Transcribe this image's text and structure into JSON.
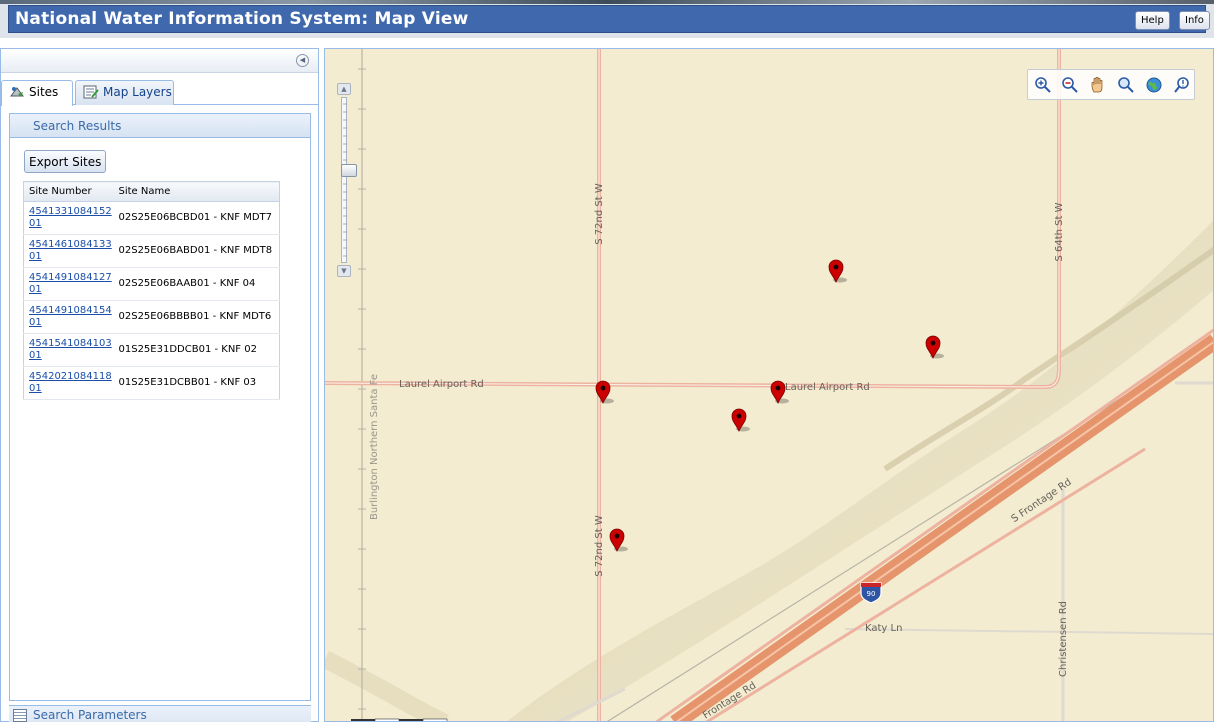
{
  "header": {
    "title": "National Water Information System: Map View",
    "help_label": "Help",
    "info_label": "Info"
  },
  "tabs": [
    {
      "label": "Sites",
      "icon": "sites-icon",
      "selected": true
    },
    {
      "label": "Map Layers",
      "icon": "map-layers-icon",
      "selected": false
    }
  ],
  "results": {
    "title": "Search Results",
    "export_label": "Export Sites",
    "columns": [
      "Site Number",
      "Site Name"
    ],
    "rows": [
      {
        "number": "454133108415201",
        "name": "02S25E06BCBD01 - KNF MDT7"
      },
      {
        "number": "454146108413301",
        "name": "02S25E06BABD01 - KNF MDT8"
      },
      {
        "number": "454149108412701",
        "name": "02S25E06BAAB01 - KNF 04"
      },
      {
        "number": "454149108415401",
        "name": "02S25E06BBBB01 - KNF MDT6"
      },
      {
        "number": "454154108410301",
        "name": "01S25E31DDCB01 - KNF 02"
      },
      {
        "number": "454202108411801",
        "name": "01S25E31DCBB01 - KNF 03"
      }
    ]
  },
  "search_params_label": "Search Parameters",
  "map": {
    "labels": {
      "s72_north": "S 72nd St W",
      "s72_south": "S 72nd St W",
      "s64": "S 64th St W",
      "laurel_west": "Laurel Airport Rd",
      "laurel_east": "Laurel Airport Rd",
      "railroad": "Burlington Northern Santa Fe",
      "frontage_ne": "S Frontage Rd",
      "frontage_sw": "Frontage Rd",
      "katy": "Katy Ln",
      "christensen": "Christensen Rd",
      "interstate": "90"
    },
    "tools": [
      "zoom-in-icon",
      "zoom-out-icon",
      "pan-hand-icon",
      "zoom-box-icon",
      "full-extent-globe-icon",
      "identify-icon"
    ],
    "colors": {
      "background": "#f3ecd0",
      "interstate": "#e6946c",
      "road": "#e8aa98",
      "marker": "#cc0000"
    }
  }
}
